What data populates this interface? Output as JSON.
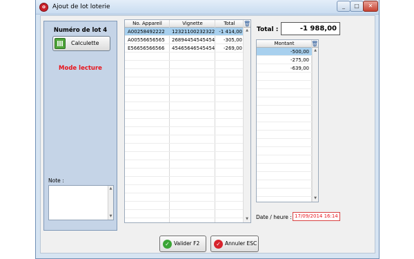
{
  "window": {
    "title": "Ajout de lot loterie",
    "app_icon": "app-icon"
  },
  "left": {
    "lot_title": "Numéro de lot 4",
    "calc_button": "Calculette",
    "mode": "Mode lecture",
    "note_label": "Note :"
  },
  "grid1": {
    "headers": [
      "No. Appareil",
      "Vignette",
      "Total"
    ],
    "rows": [
      [
        "A00258492222",
        "12321100232322",
        "-1 414,00"
      ],
      [
        "A00556656565",
        "26894454545454",
        "-305,00"
      ],
      [
        "E56656566566",
        "45465646545454",
        "-269,00"
      ]
    ]
  },
  "total": {
    "label": "Total :",
    "value": "-1 988,00"
  },
  "grid2": {
    "header": "Montant",
    "rows": [
      "-500,00",
      "-275,00",
      "-639,00"
    ]
  },
  "date": {
    "label": "Date / heure :",
    "value": "17/09/2014 16:14"
  },
  "buttons": {
    "ok": "Valider  F2",
    "cancel": "Annuler  ESC"
  },
  "colors": {
    "accent_red": "#e8141c",
    "selection": "#a8d0ee",
    "panel": "#c5d4e7"
  }
}
